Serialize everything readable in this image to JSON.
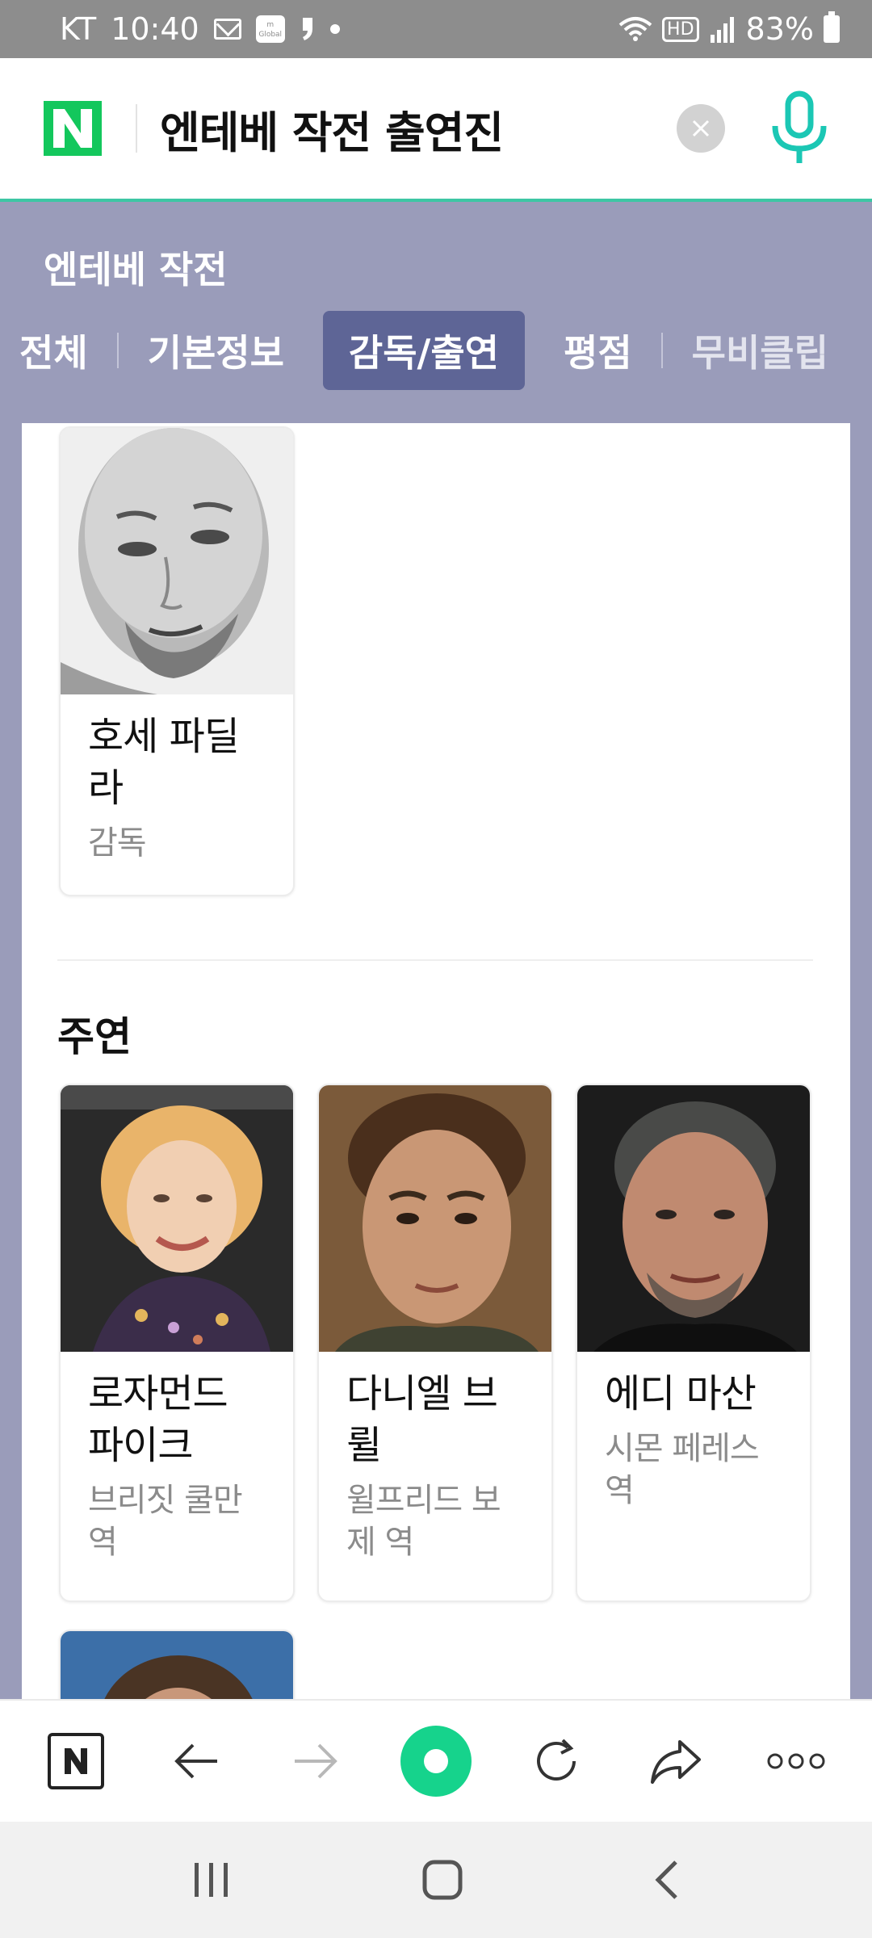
{
  "status_bar": {
    "carrier": "KT",
    "time": "10:40",
    "global_badge": "Global",
    "battery": "83%",
    "hd_label": "HD"
  },
  "search": {
    "query": "엔테베 작전 출연진",
    "logo_letter": "N"
  },
  "band": {
    "title": "엔테베 작전",
    "tabs": [
      {
        "label": "전체"
      },
      {
        "label": "기본정보"
      },
      {
        "label": "감독/출연"
      },
      {
        "label": "평점"
      },
      {
        "label": "무비클립"
      }
    ]
  },
  "director": {
    "name": "호세 파딜라",
    "role": "감독"
  },
  "main_cast": {
    "title": "주연",
    "people": [
      {
        "name": "로자먼드 파이크",
        "role": "브리짓 쿨만 역"
      },
      {
        "name": "다니엘 브륄",
        "role": "윌프리드 보제 역"
      },
      {
        "name": "에디 마산",
        "role": "시몬 페레스 역"
      }
    ]
  },
  "bottom_bar": {
    "home_letter": "N"
  },
  "colors": {
    "band": "#9a9cba",
    "active_tab": "#5e6596",
    "naver_green": "#13c75c",
    "accent_teal": "#3ec6a4"
  }
}
